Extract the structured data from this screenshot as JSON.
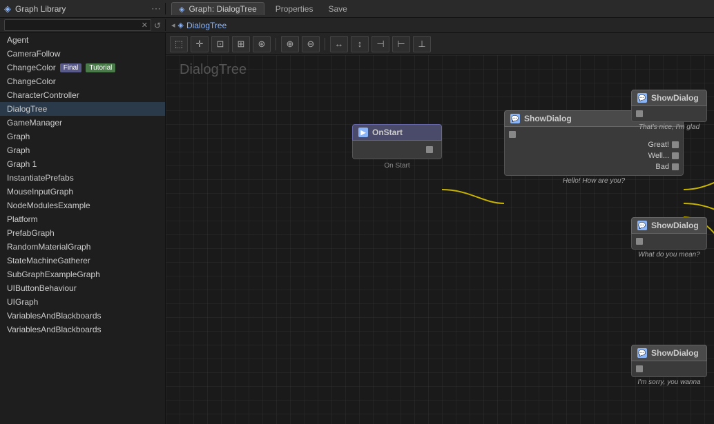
{
  "topbar": {
    "left_title": "Graph Library",
    "dots_icon": "⋯",
    "tab_icon": "◈",
    "tab_label": "Graph: DialogTree",
    "properties_btn": "Properties",
    "save_btn": "Save"
  },
  "secondbar": {
    "search_placeholder": "",
    "clear_icon": "✕",
    "refresh_icon": "↺",
    "breadcrumb_icon": "◈",
    "breadcrumb_label": "DialogTree",
    "breadcrumb_arrow": "◂"
  },
  "toolbar": {
    "tools": [
      {
        "name": "marquee",
        "icon": "⬚"
      },
      {
        "name": "move",
        "icon": "✛"
      },
      {
        "name": "align",
        "icon": "⊡"
      },
      {
        "name": "frame",
        "icon": "⊞"
      },
      {
        "name": "connect",
        "icon": "⊛"
      },
      {
        "name": "zoom-in",
        "icon": "⊕"
      },
      {
        "name": "zoom-out",
        "icon": "⊖"
      },
      {
        "name": "fit-h",
        "icon": "↔"
      },
      {
        "name": "fit-v",
        "icon": "↕"
      },
      {
        "name": "align-left",
        "icon": "⊣"
      },
      {
        "name": "align-right",
        "icon": "⊢"
      },
      {
        "name": "distribute",
        "icon": "⊥"
      },
      {
        "name": "space",
        "icon": "⊞"
      }
    ]
  },
  "graph": {
    "title": "DialogTree",
    "nodes": {
      "onstart": {
        "label": "OnStart",
        "sublabel": "On Start"
      },
      "showdialog_center": {
        "label": "ShowDialog",
        "dialog_text": "Hello! How are you?",
        "outputs": [
          "Great!",
          "Well...",
          "Bad"
        ]
      },
      "showdialog_right1": {
        "label": "ShowDialog",
        "dialog_text": "That's nice, I'm glad"
      },
      "showdialog_right2": {
        "label": "ShowDialog",
        "dialog_text": "What do you mean?"
      },
      "showdialog_right3": {
        "label": "ShowDialog",
        "dialog_text": "I'm sorry, you wanna"
      }
    }
  },
  "sidebar": {
    "items": [
      {
        "label": "Agent"
      },
      {
        "label": "CameraFollow"
      },
      {
        "label": "ChangeColor",
        "badges": [
          {
            "text": "Final",
            "type": "final"
          },
          {
            "text": "Tutorial",
            "type": "tutorial"
          }
        ]
      },
      {
        "label": "ChangeColor"
      },
      {
        "label": "CharacterController"
      },
      {
        "label": "DialogTree"
      },
      {
        "label": "GameManager"
      },
      {
        "label": "Graph"
      },
      {
        "label": "Graph"
      },
      {
        "label": "Graph 1"
      },
      {
        "label": "InstantiatePrefabs"
      },
      {
        "label": "MouseInputGraph"
      },
      {
        "label": "NodeModulesExample"
      },
      {
        "label": "Platform"
      },
      {
        "label": "PrefabGraph"
      },
      {
        "label": "RandomMaterialGraph"
      },
      {
        "label": "StateMachineGatherer"
      },
      {
        "label": "SubGraphExampleGraph"
      },
      {
        "label": "UIButtonBehaviour"
      },
      {
        "label": "UIGraph"
      },
      {
        "label": "VariablesAndBlackboards"
      },
      {
        "label": "VariablesAndBlackboards"
      }
    ]
  }
}
